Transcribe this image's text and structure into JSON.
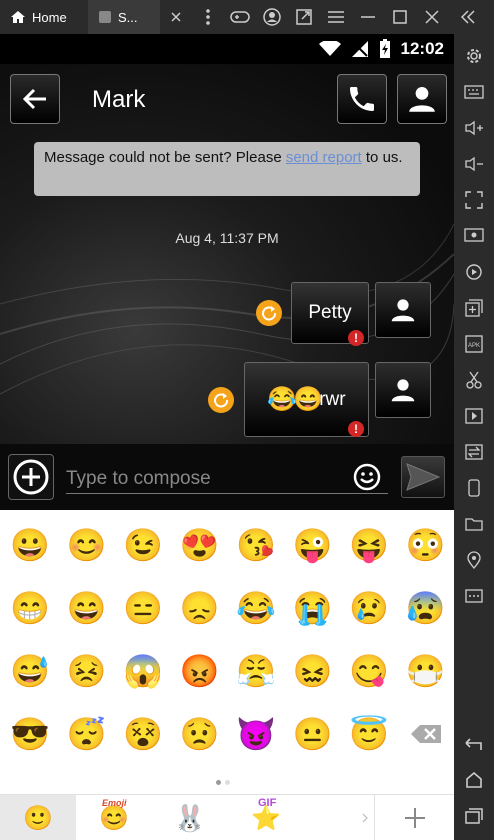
{
  "emulator": {
    "tabs": [
      {
        "label": "Home",
        "icon": "home-icon"
      },
      {
        "label": "S...",
        "icon": "app-icon"
      }
    ]
  },
  "status_bar": {
    "time": "12:02"
  },
  "conversation": {
    "contact_name": "Mark",
    "error_text_before": "Message could not be sent? Please ",
    "error_link": "send report",
    "error_text_after": " to us.",
    "timestamp": "Aug 4, 11:37 PM",
    "messages": [
      {
        "text": "Petty",
        "status": "failed"
      },
      {
        "text": "rwr",
        "emoji_prefix": "😂😄",
        "status": "failed"
      }
    ]
  },
  "composer": {
    "placeholder": "Type to compose"
  },
  "emoji_keyboard": {
    "rows": [
      [
        "😀",
        "😊",
        "😉",
        "😍",
        "😘",
        "😜",
        "😝",
        "😳"
      ],
      [
        "😁",
        "😄",
        "😑",
        "😞",
        "😂",
        "😭",
        "😢",
        "😰"
      ],
      [
        "😅",
        "😣",
        "😱",
        "😡",
        "😤",
        "😖",
        "😋",
        "😷"
      ],
      [
        "😎",
        "😴",
        "😵",
        "😟",
        "😈",
        "😐",
        "😇",
        "⌫"
      ]
    ],
    "tabs": [
      {
        "name": "smiley-tab",
        "label": "",
        "active": true
      },
      {
        "name": "emoji-pack-tab",
        "label": "Emoji",
        "active": false
      },
      {
        "name": "sticker-tab",
        "label": "",
        "active": false
      },
      {
        "name": "gif-tab",
        "label": "GIF",
        "active": false
      }
    ],
    "colors": {
      "emoji_yellow": "#f7c43f",
      "active_tab": "#e8e8e8"
    }
  }
}
